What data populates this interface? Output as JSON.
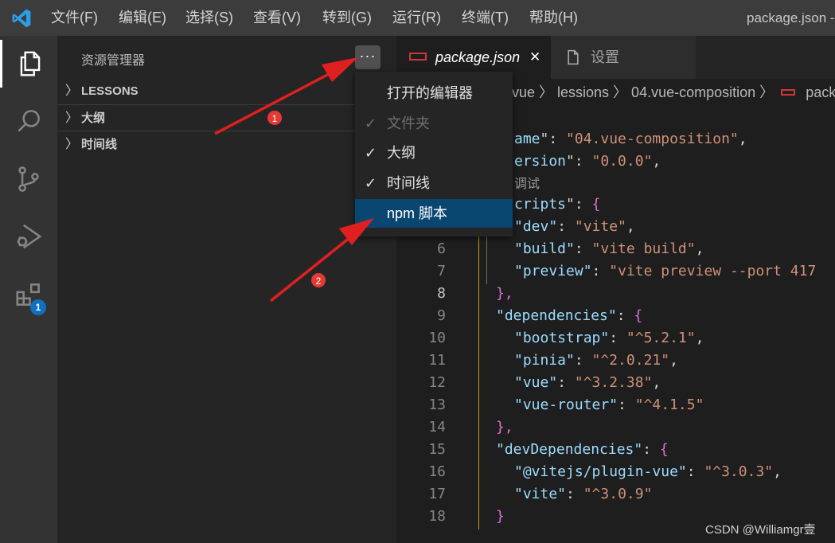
{
  "titlebar": {
    "menus": [
      "文件(F)",
      "编辑(E)",
      "选择(S)",
      "查看(V)",
      "转到(G)",
      "运行(R)",
      "终端(T)",
      "帮助(H)"
    ],
    "title": "package.json -"
  },
  "activitybar": {
    "items": [
      "explorer-icon",
      "search-icon",
      "source-control-icon",
      "run-debug-icon",
      "extensions-icon"
    ],
    "extensions_badge": "1"
  },
  "sidebar": {
    "title": "资源管理器",
    "more": "···",
    "sections": [
      "LESSONS",
      "大纲",
      "时间线"
    ]
  },
  "context_menu": {
    "items": [
      {
        "label": "打开的编辑器",
        "checked": false,
        "disabled": false
      },
      {
        "label": "文件夹",
        "checked": true,
        "disabled": true
      },
      {
        "label": "大纲",
        "checked": true,
        "disabled": false
      },
      {
        "label": "时间线",
        "checked": true,
        "disabled": false
      },
      {
        "label": "npm 脚本",
        "checked": false,
        "disabled": false,
        "highlighted": true
      }
    ],
    "check_glyph": "✓"
  },
  "tabs": [
    {
      "label": "package.json",
      "active": true,
      "close": "✕"
    },
    {
      "label": "设置",
      "active": false
    }
  ],
  "breadcrumb": {
    "text": "vue  〉 lessions 〉 04.vue-composition 〉",
    "tail": "pack"
  },
  "editor": {
    "hint": "调试",
    "lines": [
      {
        "n": "",
        "t": [
          [
            "k",
            "ame"
          ],
          [
            "p",
            "\": "
          ],
          [
            "s",
            "\"04.vue-composition\""
          ],
          [
            "p",
            ","
          ]
        ]
      },
      {
        "n": "",
        "t": [
          [
            "k",
            "ersion"
          ],
          [
            "p",
            "\": "
          ],
          [
            "s",
            "\"0.0.0\""
          ],
          [
            "p",
            ","
          ]
        ]
      },
      {
        "n": "",
        "t": [
          [
            "k",
            "cripts"
          ],
          [
            "p",
            "\": "
          ],
          [
            "b1",
            "{"
          ]
        ]
      },
      {
        "n": "",
        "t": [
          [
            "k",
            "\"dev\""
          ],
          [
            "p",
            ": "
          ],
          [
            "s",
            "\"vite\""
          ],
          [
            "p",
            ","
          ]
        ]
      },
      {
        "n": "6",
        "t": [
          [
            "k",
            "  \"build\""
          ],
          [
            "p",
            ": "
          ],
          [
            "s",
            "\"vite build\""
          ],
          [
            "p",
            ","
          ]
        ]
      },
      {
        "n": "7",
        "t": [
          [
            "k",
            "  \"preview\""
          ],
          [
            "p",
            ": "
          ],
          [
            "s",
            "\"vite preview --port 417"
          ]
        ]
      },
      {
        "n": "8",
        "t": [
          [
            "b1",
            "},"
          ]
        ]
      },
      {
        "n": "9",
        "t": [
          [
            "k",
            "\"dependencies\""
          ],
          [
            "p",
            ": "
          ],
          [
            "b1",
            "{"
          ]
        ]
      },
      {
        "n": "10",
        "t": [
          [
            "k",
            "  \"bootstrap\""
          ],
          [
            "p",
            ": "
          ],
          [
            "s",
            "\"^5.2.1\""
          ],
          [
            "p",
            ","
          ]
        ]
      },
      {
        "n": "11",
        "t": [
          [
            "k",
            "  \"pinia\""
          ],
          [
            "p",
            ": "
          ],
          [
            "s",
            "\"^2.0.21\""
          ],
          [
            "p",
            ","
          ]
        ]
      },
      {
        "n": "12",
        "t": [
          [
            "k",
            "  \"vue\""
          ],
          [
            "p",
            ": "
          ],
          [
            "s",
            "\"^3.2.38\""
          ],
          [
            "p",
            ","
          ]
        ]
      },
      {
        "n": "13",
        "t": [
          [
            "k",
            "  \"vue-router\""
          ],
          [
            "p",
            ": "
          ],
          [
            "s",
            "\"^4.1.5\""
          ]
        ]
      },
      {
        "n": "14",
        "t": [
          [
            "b1",
            "},"
          ]
        ]
      },
      {
        "n": "15",
        "t": [
          [
            "k",
            "\"devDependencies\""
          ],
          [
            "p",
            ": "
          ],
          [
            "b1",
            "{"
          ]
        ]
      },
      {
        "n": "16",
        "t": [
          [
            "k",
            "  \"@vitejs/plugin-vue\""
          ],
          [
            "p",
            ": "
          ],
          [
            "s",
            "\"^3.0.3\""
          ],
          [
            "p",
            ","
          ]
        ]
      },
      {
        "n": "17",
        "t": [
          [
            "k",
            "  \"vite\""
          ],
          [
            "p",
            ": "
          ],
          [
            "s",
            "\"^3.0.9\""
          ]
        ]
      },
      {
        "n": "18",
        "t": [
          [
            "b1",
            "}"
          ]
        ]
      }
    ],
    "current_line": "8"
  },
  "annotations": {
    "marker1": "1",
    "marker2": "2",
    "color": "#e02020"
  },
  "watermark": "CSDN @Williamgr壹",
  "colors": {
    "accent": "#0e70c0",
    "highlight": "#094771"
  }
}
